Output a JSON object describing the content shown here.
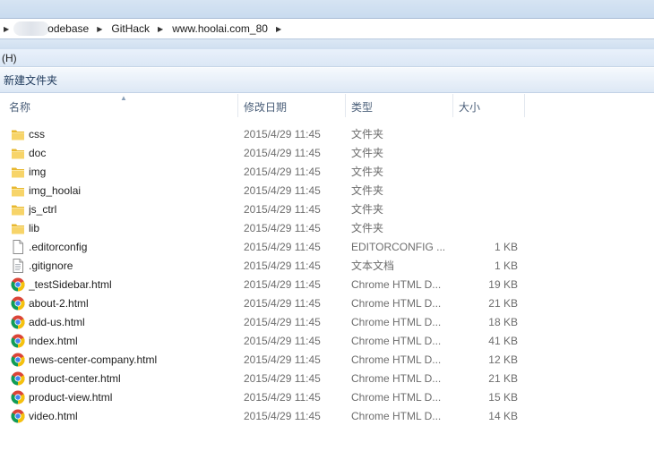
{
  "address": {
    "crumbs": [
      "odebase",
      "GitHack",
      "www.hoolai.com_80"
    ]
  },
  "menu": {
    "help": "(H)"
  },
  "toolbar": {
    "new_folder": "新建文件夹"
  },
  "columns": {
    "name": "名称",
    "date": "修改日期",
    "type": "类型",
    "size": "大小"
  },
  "files": [
    {
      "name": "css",
      "date": "2015/4/29 11:45",
      "type": "文件夹",
      "size": "",
      "icon": "folder-icon"
    },
    {
      "name": "doc",
      "date": "2015/4/29 11:45",
      "type": "文件夹",
      "size": "",
      "icon": "folder-icon"
    },
    {
      "name": "img",
      "date": "2015/4/29 11:45",
      "type": "文件夹",
      "size": "",
      "icon": "folder-icon"
    },
    {
      "name": "img_hoolai",
      "date": "2015/4/29 11:45",
      "type": "文件夹",
      "size": "",
      "icon": "folder-icon"
    },
    {
      "name": "js_ctrl",
      "date": "2015/4/29 11:45",
      "type": "文件夹",
      "size": "",
      "icon": "folder-icon"
    },
    {
      "name": "lib",
      "date": "2015/4/29 11:45",
      "type": "文件夹",
      "size": "",
      "icon": "folder-icon"
    },
    {
      "name": ".editorconfig",
      "date": "2015/4/29 11:45",
      "type": "EDITORCONFIG ...",
      "size": "1 KB",
      "icon": "blank-file-icon"
    },
    {
      "name": ".gitignore",
      "date": "2015/4/29 11:45",
      "type": "文本文档",
      "size": "1 KB",
      "icon": "text-file-icon"
    },
    {
      "name": "_testSidebar.html",
      "date": "2015/4/29 11:45",
      "type": "Chrome HTML D...",
      "size": "19 KB",
      "icon": "chrome-icon"
    },
    {
      "name": "about-2.html",
      "date": "2015/4/29 11:45",
      "type": "Chrome HTML D...",
      "size": "21 KB",
      "icon": "chrome-icon"
    },
    {
      "name": "add-us.html",
      "date": "2015/4/29 11:45",
      "type": "Chrome HTML D...",
      "size": "18 KB",
      "icon": "chrome-icon"
    },
    {
      "name": "index.html",
      "date": "2015/4/29 11:45",
      "type": "Chrome HTML D...",
      "size": "41 KB",
      "icon": "chrome-icon"
    },
    {
      "name": "news-center-company.html",
      "date": "2015/4/29 11:45",
      "type": "Chrome HTML D...",
      "size": "12 KB",
      "icon": "chrome-icon"
    },
    {
      "name": "product-center.html",
      "date": "2015/4/29 11:45",
      "type": "Chrome HTML D...",
      "size": "21 KB",
      "icon": "chrome-icon"
    },
    {
      "name": "product-view.html",
      "date": "2015/4/29 11:45",
      "type": "Chrome HTML D...",
      "size": "15 KB",
      "icon": "chrome-icon"
    },
    {
      "name": "video.html",
      "date": "2015/4/29 11:45",
      "type": "Chrome HTML D...",
      "size": "14 KB",
      "icon": "chrome-icon"
    }
  ]
}
